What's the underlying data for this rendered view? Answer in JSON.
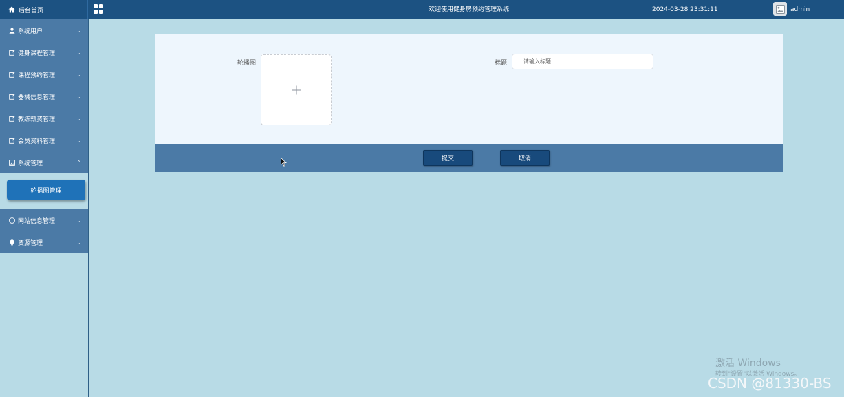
{
  "header": {
    "home_label": "后台首页",
    "welcome": "欢迎使用健身房预约管理系统",
    "datetime": "2024-03-28 23:31:11",
    "username": "admin",
    "icons": {
      "home": "home-icon",
      "grid": "grid-icon",
      "avatar": "avatar-icon"
    }
  },
  "sidebar": {
    "items": [
      {
        "label": "系统用户",
        "icon": "user-icon",
        "expanded": false
      },
      {
        "label": "健身课程管理",
        "icon": "edit-icon",
        "expanded": false
      },
      {
        "label": "课程预约管理",
        "icon": "edit-icon",
        "expanded": false
      },
      {
        "label": "器械信息管理",
        "icon": "edit-icon",
        "expanded": false
      },
      {
        "label": "教练薪资管理",
        "icon": "edit-icon",
        "expanded": false
      },
      {
        "label": "会员资料管理",
        "icon": "edit-icon",
        "expanded": false
      },
      {
        "label": "系统管理",
        "icon": "image-icon",
        "expanded": true
      },
      {
        "label": "网站信息管理",
        "icon": "info-icon",
        "expanded": false
      },
      {
        "label": "资源管理",
        "icon": "bulb-icon",
        "expanded": false
      }
    ],
    "submenu": {
      "active_item": "轮播图管理"
    }
  },
  "form": {
    "image_label": "轮播图",
    "title_label": "标题",
    "title_placeholder": "请输入标题",
    "title_value": ""
  },
  "actions": {
    "submit_label": "提交",
    "cancel_label": "取消"
  },
  "watermark": {
    "activate_title": "激活 Windows",
    "activate_hint": "转到\"设置\"以激活 Windows。",
    "csdn": "CSDN @81330-BS"
  },
  "colors": {
    "header_bg": "#1c5282",
    "menu_bg": "#4b7aa6",
    "page_bg": "#b8dbe6",
    "active_submenu": "#1f72b8",
    "button_bg": "#184a7c"
  }
}
